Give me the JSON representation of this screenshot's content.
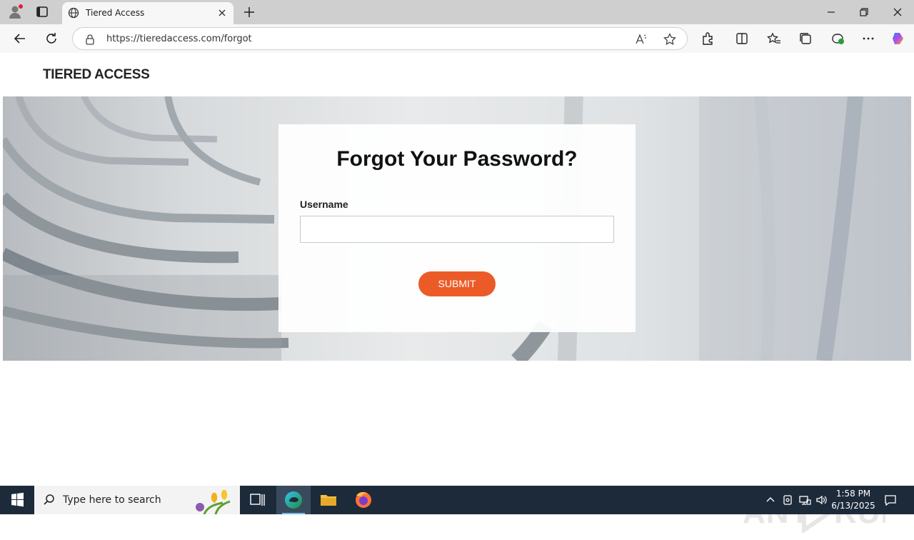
{
  "browser": {
    "tab_title": "Tiered Access",
    "url": "https://tieredaccess.com/forgot"
  },
  "site": {
    "brand": "TIERED ACCESS",
    "form": {
      "title": "Forgot Your Password?",
      "username_label": "Username",
      "username_value": "",
      "submit_label": "SUBMIT"
    }
  },
  "watermark": "ANY RUN",
  "taskbar": {
    "search_placeholder": "Type here to search",
    "time": "1:58 PM",
    "date": "6/13/2025"
  },
  "colors": {
    "accent": "#ec5b27",
    "taskbar": "#1d2a3a"
  }
}
